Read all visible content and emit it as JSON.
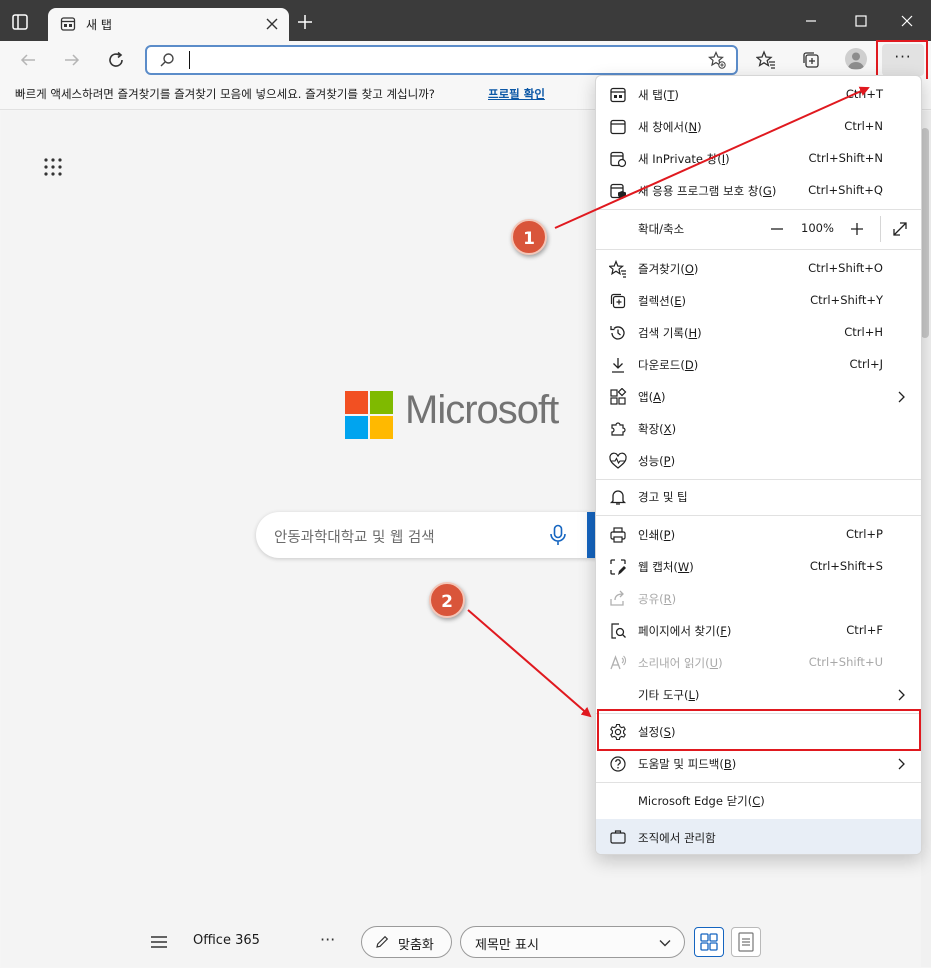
{
  "tab": {
    "title": "새 탭"
  },
  "favorites_bar": {
    "message": "빠르게 액세스하려면 즐겨찾기를 즐겨찾기 모음에 넣으세요. 즐겨찾기를 찾고 계십니까?",
    "link": "프로필 확인"
  },
  "page": {
    "brand": "Microsoft",
    "search_placeholder": "안동과학대학교 및 웹 검색",
    "bottom": {
      "office_label": "Office 365",
      "customize_label": "맞춤화",
      "view_select": "제목만 표시"
    }
  },
  "menu": {
    "new_tab": {
      "label": "새 탭",
      "key": "T",
      "shortcut": "Ctrl+T"
    },
    "new_window": {
      "label": "새 창에서",
      "key": "N",
      "shortcut": "Ctrl+N"
    },
    "new_inprivate": {
      "label": "새 InPrivate 창",
      "key": "I",
      "shortcut": "Ctrl+Shift+N"
    },
    "new_app_guard": {
      "label": "새 응용 프로그램 보호 창",
      "key": "G",
      "shortcut": "Ctrl+Shift+Q"
    },
    "zoom": {
      "label": "확대/축소",
      "value": "100%"
    },
    "favorites": {
      "label": "즐겨찾기",
      "key": "O",
      "shortcut": "Ctrl+Shift+O"
    },
    "collections": {
      "label": "컬렉션",
      "key": "E",
      "shortcut": "Ctrl+Shift+Y"
    },
    "history": {
      "label": "검색 기록",
      "key": "H",
      "shortcut": "Ctrl+H"
    },
    "downloads": {
      "label": "다운로드",
      "key": "D",
      "shortcut": "Ctrl+J"
    },
    "apps": {
      "label": "앱",
      "key": "A"
    },
    "extensions": {
      "label": "확장",
      "key": "X"
    },
    "performance": {
      "label": "성능",
      "key": "P"
    },
    "alerts": {
      "label": "경고 및 팁"
    },
    "print": {
      "label": "인쇄",
      "key": "P",
      "shortcut": "Ctrl+P"
    },
    "web_capture": {
      "label": "웹 캡처",
      "key": "W",
      "shortcut": "Ctrl+Shift+S"
    },
    "share": {
      "label": "공유",
      "key": "R"
    },
    "find": {
      "label": "페이지에서 찾기",
      "key": "F",
      "shortcut": "Ctrl+F"
    },
    "read_aloud": {
      "label": "소리내어 읽기",
      "key": "U",
      "shortcut": "Ctrl+Shift+U"
    },
    "more_tools": {
      "label": "기타 도구",
      "key": "L"
    },
    "settings": {
      "label": "설정",
      "key": "S"
    },
    "help": {
      "label": "도움말 및 피드백",
      "key": "B"
    },
    "close_edge": {
      "label": "Microsoft Edge 닫기",
      "key": "C"
    },
    "managed": {
      "label": "조직에서 관리함"
    }
  },
  "annotations": {
    "step1": "1",
    "step2": "2"
  },
  "colors": {
    "highlight": "#e0191f",
    "badge": "#d9553a",
    "accent": "#1565c0"
  }
}
